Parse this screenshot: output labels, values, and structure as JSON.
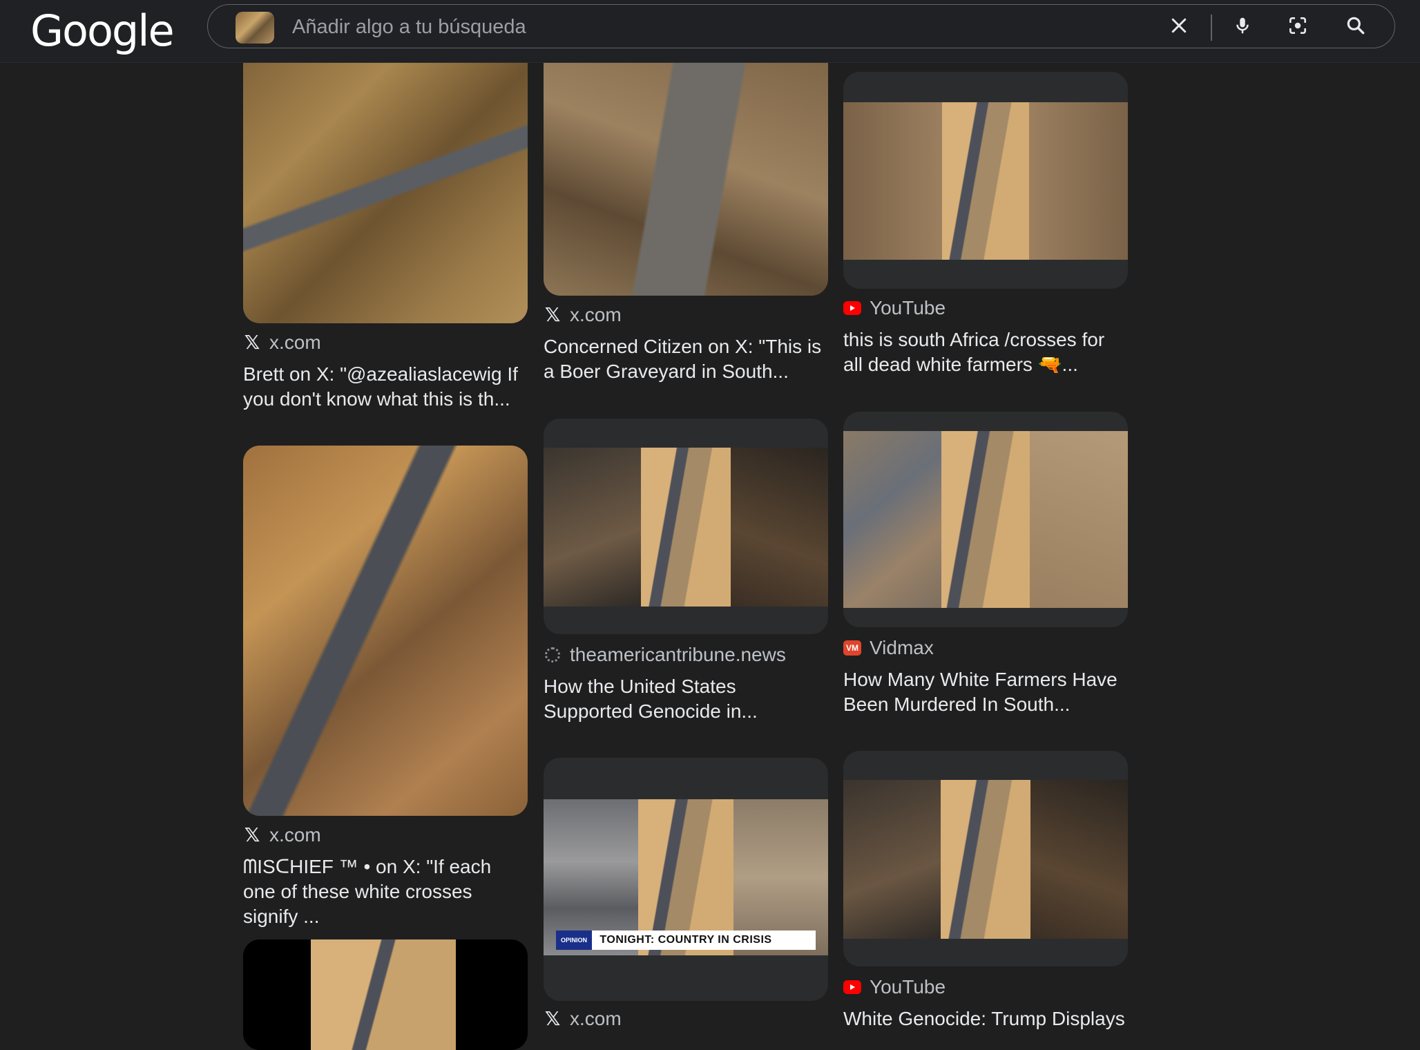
{
  "header": {
    "logo": "Google",
    "search": {
      "placeholder": "Añadir algo a tu búsqueda",
      "value": ""
    },
    "icons": [
      "close-icon",
      "mic-icon",
      "lens-icon",
      "search-icon"
    ]
  },
  "results": [
    {
      "source": "x.com",
      "source_icon": "x-logo-icon",
      "title": "Brett on X: \"@azealiaslacewig If you don't know what this is th..."
    },
    {
      "source": "x.com",
      "source_icon": "x-logo-icon",
      "title": "Concerned Citizen on X: \"This is a Boer Graveyard in South..."
    },
    {
      "source": "YouTube",
      "source_icon": "youtube-icon",
      "title": "this is south Africa /crosses for all dead white farmers 🔫..."
    },
    {
      "source": "x.com",
      "source_icon": "x-logo-icon",
      "title": "ᗰISᑕHIEF ™ • on X: \"If each one of these white crosses signify ..."
    },
    {
      "source": "theamericantribune.news",
      "source_icon": "globe-icon",
      "title": "How the United States Supported Genocide in..."
    },
    {
      "source": "Vidmax",
      "source_icon": "vidmax-icon",
      "title": "How Many White Farmers Have Been Murdered In South..."
    },
    {
      "source": "x.com",
      "source_icon": "x-logo-icon",
      "title": ""
    },
    {
      "source": "YouTube",
      "source_icon": "youtube-icon",
      "title": "White Genocide: Trump Displays"
    }
  ],
  "overlays": {
    "news_headline": "TONIGHT: COUNTRY IN CRISIS",
    "news_tag": "OPINION"
  },
  "colors": {
    "background": "#1f1f1f",
    "card": "#2b2c2e",
    "text": "#e8eaed",
    "muted": "#bdc1c6",
    "youtube_red": "#ff0000",
    "vidmax_orange": "#e0452b"
  }
}
